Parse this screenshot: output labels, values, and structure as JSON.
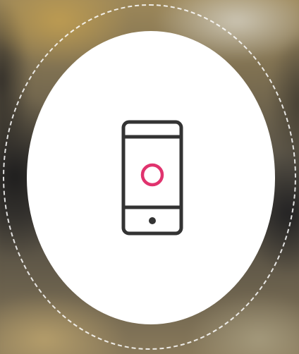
{
  "icon": {
    "name": "smartphone-icon",
    "stroke_color": "#333333",
    "accent_color": "#e0336e"
  },
  "colors": {
    "disc": "#ffffff",
    "dashed_ring": "#ffffff"
  }
}
